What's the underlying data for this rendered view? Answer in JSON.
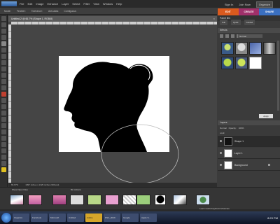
{
  "menubar": {
    "items": [
      "File",
      "Edit",
      "Image",
      "Enhance",
      "Layer",
      "Select",
      "Filter",
      "View",
      "Window",
      "Help"
    ],
    "sign_in": "Sign In",
    "join_now": "Join Now",
    "organize": "Organize"
  },
  "options": {
    "items": [
      "Mode:",
      "Feather:",
      "Tolerance:",
      "Anti-alias",
      "Contiguous"
    ]
  },
  "document": {
    "title": "Untitled-2 @ 66.7% (Shape 1, RGB/8)",
    "close": "×",
    "status": [
      "66.67%",
      "1097 inches x 1329 inches (300 ppi)"
    ]
  },
  "modes": {
    "edit": "EDIT",
    "create": "CREATE",
    "share": "SHARE"
  },
  "panel_bin": {
    "title": "Panel Bin"
  },
  "effects": {
    "title": "Effects",
    "modes": [
      "Full",
      "Quick",
      "Guided"
    ],
    "dropdown": "Normal",
    "apply": "Apply"
  },
  "layers": {
    "title": "Layers",
    "blend": "Normal",
    "opacity_label": "Opacity:",
    "opacity": "100%",
    "lock_label": "Lock:",
    "rows": [
      {
        "name": "Shape 1"
      },
      {
        "name": "Layer 1"
      },
      {
        "name": "Background"
      }
    ]
  },
  "project_bin": {
    "tab1": "Show Open Files",
    "tab2": "Bin Actions",
    "status": "Learn useful keyboard shortcuts"
  },
  "taskbar": {
    "items": [
      "Organize",
      "Facebook",
      "Microsoft",
      "Untitled",
      "Adobe",
      "DSC_0019",
      "Google",
      "Apple S..."
    ],
    "active_index": 4,
    "clock": "8:23 PM"
  },
  "colors": {
    "edit_tab": "#d95a1e",
    "create_tab": "#a0306a",
    "share_tab": "#3a6fc0",
    "silhouette": "#000000",
    "canvas": "#ffffff"
  }
}
